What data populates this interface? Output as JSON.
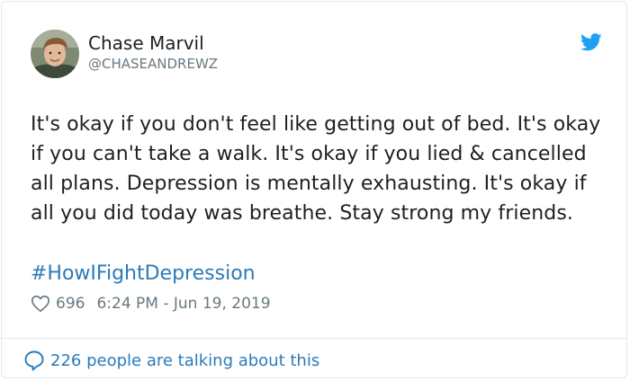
{
  "author": {
    "display_name": "Chase Marvil",
    "handle": "@CHASEANDREWZ",
    "avatar_icon": "user-avatar-photo"
  },
  "tweet": {
    "text": "It's okay if you don't feel like getting out of bed. It's okay if you can't take a walk. It's okay if you lied & cancelled all plans. Depression is mentally exhausting. It's okay if all you did today was breathe. Stay strong my friends.",
    "hashtag": "#HowIFightDepression"
  },
  "meta": {
    "likes": "696",
    "timestamp": "6:24 PM - Jun 19, 2019"
  },
  "footer": {
    "conversation_label": "226 people are talking about this"
  },
  "icons": {
    "brand": "twitter-bird-icon",
    "like": "heart-icon",
    "reply": "speech-bubble-icon"
  },
  "colors": {
    "brand": "#1da1f2",
    "link": "#2b7bb9",
    "text": "#1c2022",
    "muted": "#697882",
    "border": "#e1e8ed"
  }
}
